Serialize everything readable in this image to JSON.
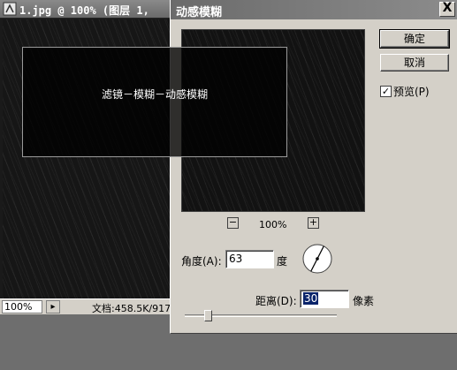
{
  "document": {
    "title": "1.jpg @ 100% (图层 1,",
    "zoom": "100%",
    "status_info": "文档:458.5K/917"
  },
  "dialog": {
    "title": "动感模糊",
    "close_label": "X",
    "ok_label": "确定",
    "cancel_label": "取消",
    "preview_label": "预览(P)",
    "preview_checked": true,
    "zoom_out_label": "−",
    "zoom_in_label": "+",
    "zoom_level": "100%",
    "angle_label": "角度(A):",
    "angle_value": "63",
    "angle_unit": "度",
    "distance_label": "距离(D):",
    "distance_value": "30",
    "distance_unit": "像素",
    "distance_slider_fraction": 0.1
  },
  "overlay": {
    "caption": "滤镜－模糊－动感模糊"
  }
}
